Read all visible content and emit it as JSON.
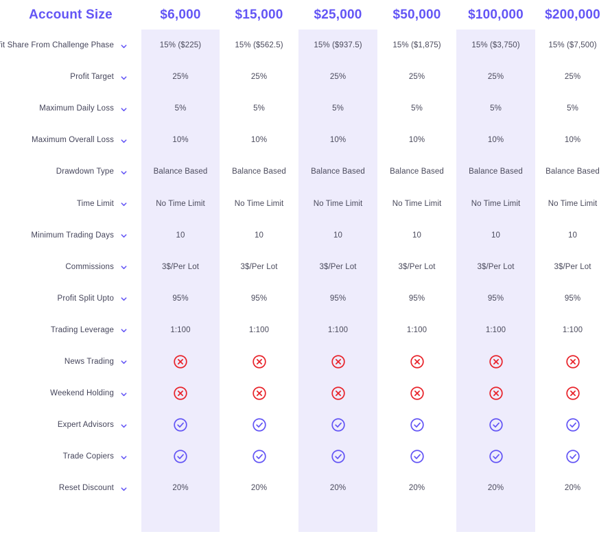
{
  "table": {
    "row_label_header": "Account Size",
    "columns": [
      {
        "label": "$6,000",
        "shaded": true
      },
      {
        "label": "$15,000",
        "shaded": false
      },
      {
        "label": "$25,000",
        "shaded": true
      },
      {
        "label": "$50,000",
        "shaded": false
      },
      {
        "label": "$100,000",
        "shaded": true
      },
      {
        "label": "$200,000",
        "shaded": false
      }
    ],
    "rows": [
      {
        "label": "Profit Share From Challenge Phase",
        "icon": "chevron-down-icon",
        "values": [
          "15% ($225)",
          "15% ($562.5)",
          "15% ($937.5)",
          "15% ($1,875)",
          "15% ($3,750)",
          "15% ($7,500)"
        ],
        "type": "text"
      },
      {
        "label": "Profit Target",
        "icon": "chevron-down-icon",
        "values": [
          "25%",
          "25%",
          "25%",
          "25%",
          "25%",
          "25%"
        ],
        "type": "text"
      },
      {
        "label": "Maximum Daily Loss",
        "icon": "chevron-down-icon",
        "values": [
          "5%",
          "5%",
          "5%",
          "5%",
          "5%",
          "5%"
        ],
        "type": "text"
      },
      {
        "label": "Maximum Overall Loss",
        "icon": "chevron-down-icon",
        "values": [
          "10%",
          "10%",
          "10%",
          "10%",
          "10%",
          "10%"
        ],
        "type": "text"
      },
      {
        "label": "Drawdown Type",
        "icon": "chevron-down-icon",
        "values": [
          "Balance Based",
          "Balance Based",
          "Balance Based",
          "Balance Based",
          "Balance Based",
          "Balance Based"
        ],
        "type": "text"
      },
      {
        "label": "Time Limit",
        "icon": "chevron-down-icon",
        "values": [
          "No Time Limit",
          "No Time Limit",
          "No Time Limit",
          "No Time Limit",
          "No Time Limit",
          "No Time Limit"
        ],
        "type": "text"
      },
      {
        "label": "Minimum Trading Days",
        "icon": "chevron-down-icon",
        "values": [
          "10",
          "10",
          "10",
          "10",
          "10",
          "10"
        ],
        "type": "text"
      },
      {
        "label": "Commissions",
        "icon": "chevron-down-icon",
        "values": [
          "3$/Per Lot",
          "3$/Per Lot",
          "3$/Per Lot",
          "3$/Per Lot",
          "3$/Per Lot",
          "3$/Per Lot"
        ],
        "type": "text"
      },
      {
        "label": "Profit Split Upto",
        "icon": "chevron-down-icon",
        "values": [
          "95%",
          "95%",
          "95%",
          "95%",
          "95%",
          "95%"
        ],
        "type": "text"
      },
      {
        "label": "Trading Leverage",
        "icon": "chevron-down-icon",
        "values": [
          "1:100",
          "1:100",
          "1:100",
          "1:100",
          "1:100",
          "1:100"
        ],
        "type": "text"
      },
      {
        "label": "News Trading",
        "icon": "chevron-down-icon",
        "values": [
          "not-allowed",
          "not-allowed",
          "not-allowed",
          "not-allowed",
          "not-allowed",
          "not-allowed"
        ],
        "type": "icon"
      },
      {
        "label": "Weekend Holding",
        "icon": "chevron-down-icon",
        "values": [
          "not-allowed",
          "not-allowed",
          "not-allowed",
          "not-allowed",
          "not-allowed",
          "not-allowed"
        ],
        "type": "icon"
      },
      {
        "label": "Expert Advisors",
        "icon": "chevron-down-icon",
        "values": [
          "allowed",
          "allowed",
          "allowed",
          "allowed",
          "allowed",
          "allowed"
        ],
        "type": "icon"
      },
      {
        "label": "Trade Copiers",
        "icon": "chevron-down-icon",
        "values": [
          "allowed",
          "allowed",
          "allowed",
          "allowed",
          "allowed",
          "allowed"
        ],
        "type": "icon"
      },
      {
        "label": "Reset Discount",
        "icon": "chevron-down-icon",
        "values": [
          "20%",
          "20%",
          "20%",
          "20%",
          "20%",
          "20%"
        ],
        "type": "text"
      }
    ]
  },
  "colors": {
    "accent": "#6355f5",
    "column_shade": "#eeecfc",
    "allowed_icon": "#6355f5",
    "not_allowed_icon": "#e8232a",
    "text": "#44445a",
    "background": "#ffffff"
  },
  "icons": {
    "allowed": "check-circle-icon",
    "not_allowed": "x-circle-icon",
    "expander": "chevron-down-icon"
  }
}
